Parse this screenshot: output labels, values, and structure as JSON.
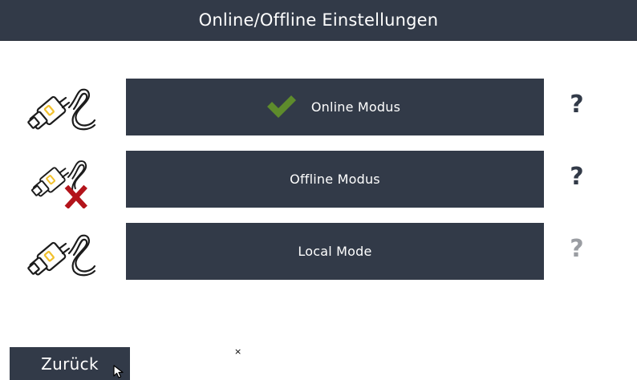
{
  "header": {
    "title": "Online/Offline Einstellungen"
  },
  "modes": [
    {
      "label": "Online Modus",
      "icon": "plug-icon",
      "selected": true,
      "help": "?"
    },
    {
      "label": "Offline Modus",
      "icon": "plug-disconnected-icon",
      "selected": false,
      "help": "?"
    },
    {
      "label": "Local Mode",
      "icon": "plug-icon",
      "selected": false,
      "help": "?",
      "help_disabled": true
    }
  ],
  "footer": {
    "back_label": "Zurück",
    "stray_mark": "×"
  },
  "colors": {
    "header_bg": "#323a48",
    "button_bg": "#323a48",
    "check_green": "#5e8b2c",
    "error_red": "#b3141b",
    "plug_yellow": "#f2c12e",
    "help_disabled": "#9a9da2"
  }
}
